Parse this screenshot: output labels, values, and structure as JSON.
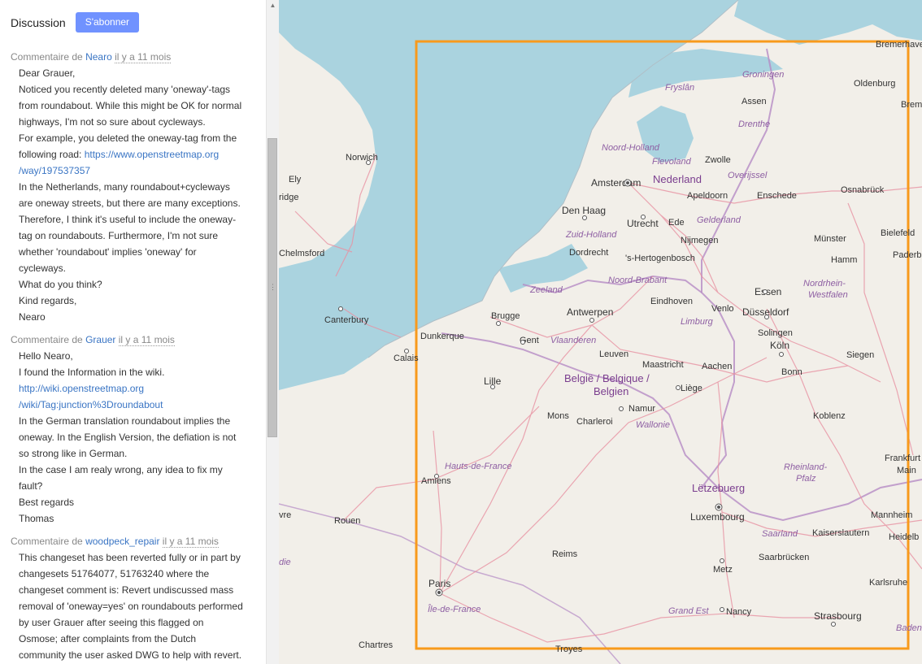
{
  "header": {
    "title": "Discussion",
    "subscribe_label": "S'abonner"
  },
  "comments": [
    {
      "prefix": "Commentaire de",
      "author": "Nearo",
      "ago": "il y a 11 mois",
      "lines": [
        "Dear Grauer,",
        "Noticed you recently deleted many 'oneway'-tags",
        "from roundabout. While this might be OK for normal",
        "highways, I'm not so sure about cycleways.",
        "For example, you deleted the oneway-tag from the",
        "/way/197537357",
        "In the Netherlands, many roundabout+cycleways",
        "are oneway streets, but there are many exceptions.",
        "Therefore, I think it's useful to include the oneway-",
        "tag on roundabouts. Furthermore, I'm not sure",
        "whether 'roundabout' implies 'oneway' for",
        "cycleways.",
        "What do you think?",
        "Kind regards,",
        "Nearo"
      ],
      "link_line_prefix": "following road: ",
      "link_line_url": "https://www.openstreetmap.org"
    },
    {
      "prefix": "Commentaire de",
      "author": "Grauer",
      "ago": "il y a 11 mois",
      "lines": [
        "Hello Nearo,",
        "I found the Information in the wiki.",
        "http://wiki.openstreetmap.org",
        "/wiki/Tag:junction%3Droundabout",
        "In the German translation roundabout implies the",
        "oneway. In the English Version, the defiation is not",
        "so strong like in German.",
        "In the case I am realy wrong, any idea to fix my",
        "fault?",
        "Best regards",
        "Thomas"
      ]
    },
    {
      "prefix": "Commentaire de",
      "author": "woodpeck_repair",
      "ago": "il y a 11 mois",
      "lines": [
        "This changeset has been reverted fully or in part by",
        "changesets 51764077, 51763240 where the",
        "changeset comment is: Revert undiscussed mass",
        "removal of 'oneway=yes' on roundabouts performed",
        "by user Grauer after seeing this flagged on",
        "Osmose; after complaints from the Dutch",
        "community the user asked DWG to help with revert."
      ]
    }
  ],
  "map": {
    "labels": {
      "groningen": "Groningen",
      "oldenburg": "Oldenburg",
      "bremerhaven": "Bremerhaven",
      "brem": "Brem",
      "fryslan": "Fryslân",
      "assen": "Assen",
      "drenthe": "Drenthe",
      "noord_holland": "Noord-Holland",
      "flevoland": "Flevoland",
      "zwolle": "Zwolle",
      "overijssel": "Overijssel",
      "amsterdam": "Amsterdam",
      "nederland": "Nederland",
      "apeldoorn": "Apeldoorn",
      "enschede": "Enschede",
      "osnabruck": "Osnabrück",
      "den_haag": "Den Haag",
      "utrecht": "Utrecht",
      "ede": "Ede",
      "gelderland": "Gelderland",
      "bielefeld": "Bielefeld",
      "zuid_holland": "Zuid-Holland",
      "nijmegen": "Nijmegen",
      "munster": "Münster",
      "dordrecht": "Dordrecht",
      "hertogenbosch": "'s-Hertogenbosch",
      "hamm": "Hamm",
      "paderborn": "Paderb",
      "noord_brabant": "Noord-Brabant",
      "nrw1": "Nordrhein-",
      "nrw2": "Westfalen",
      "zeeland": "Zeeland",
      "essen": "Essen",
      "eindhoven": "Eindhoven",
      "venlo": "Venlo",
      "dusseldorf": "Düsseldorf",
      "brugge": "Brugge",
      "antwerpen": "Antwerpen",
      "limburg": "Limburg",
      "dunkerque": "Dunkerque",
      "gent": "Gent",
      "vlaanderen": "Vlaanderen",
      "solingen": "Solingen",
      "calais": "Calais",
      "leuven": "Leuven",
      "koln": "Köln",
      "siegen": "Siegen",
      "maastricht": "Maastricht",
      "aachen": "Aachen",
      "lille": "Lille",
      "belgie1": "België / Belgique /",
      "belgie2": "Belgien",
      "bonn": "Bonn",
      "liege": "Liège",
      "namur": "Namur",
      "mons": "Mons",
      "charleroi": "Charleroi",
      "wallonie": "Wallonie",
      "koblenz": "Koblenz",
      "hauts_de_france": "Hauts-de-France",
      "frankfurt1": "Frankfurt",
      "frankfurt2": "Main",
      "amiens": "Amiens",
      "rheinland1": "Rheinland-",
      "rheinland2": "Pfalz",
      "letzebuerg": "Lëtzebuerg",
      "luxembourg": "Luxembourg",
      "rouen": "Rouen",
      "mannheim": "Mannheim",
      "saarland": "Saarland",
      "kaiserslautern": "Kaiserslautern",
      "heidelberg": "Heidelb",
      "reims": "Reims",
      "saarbrucken": "Saarbrücken",
      "metz": "Metz",
      "paris": "Paris",
      "karlsruhe": "Karlsruhe",
      "ile_de_france": "Île-de-France",
      "grand_est": "Grand Est",
      "nancy": "Nancy",
      "strasbourg": "Strasbourg",
      "chartres": "Chartres",
      "troyes": "Troyes",
      "baden": "Baden",
      "norwich": "Norwich",
      "ely": "Ely",
      "cambridge": "ridge",
      "chelmsford": "Chelmsford",
      "canterbury": "Canterbury",
      "vre": "vre",
      "die": "die"
    },
    "colors": {
      "water": "#aad3df",
      "land": "#f2efe9",
      "bbox": "#f89a1c",
      "border": "#b58bc4",
      "road": "#e892a2"
    }
  }
}
